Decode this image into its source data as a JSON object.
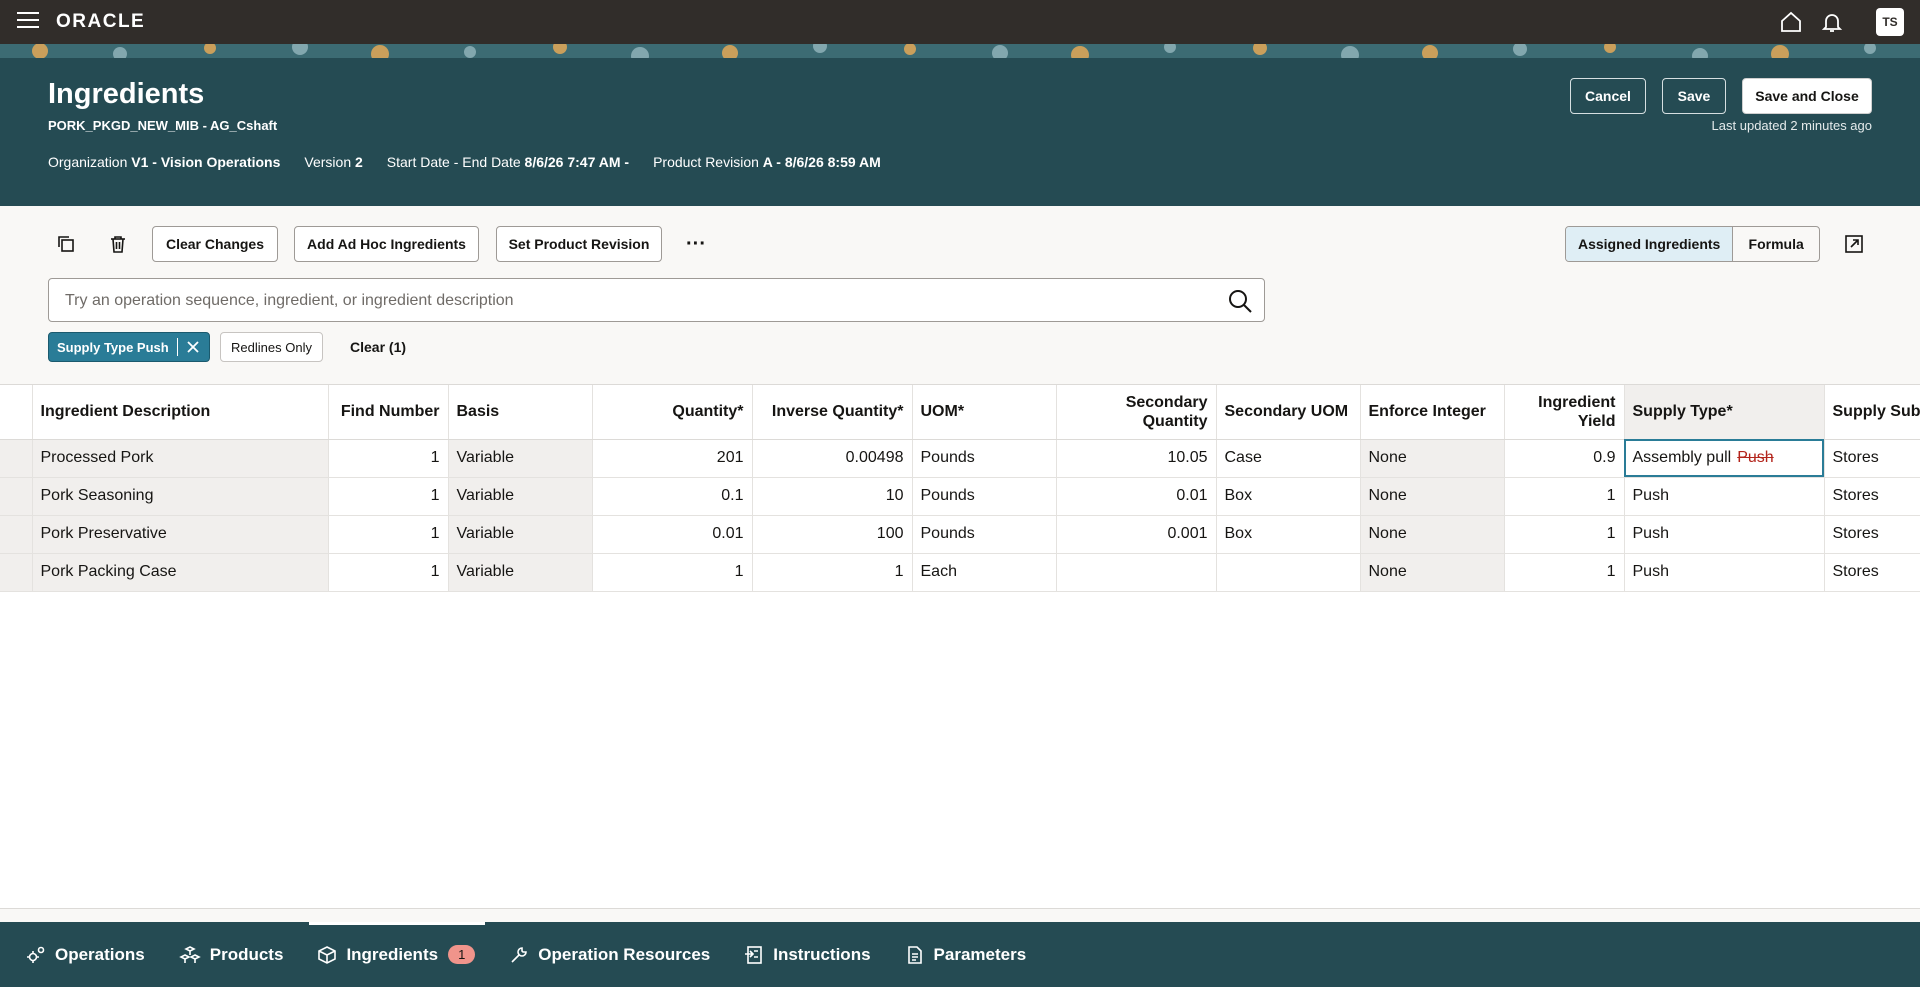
{
  "topbar": {
    "logo": "ORACLE",
    "avatar_initials": "TS",
    "icons": [
      "menu-icon",
      "home-icon",
      "bell-icon"
    ]
  },
  "header": {
    "title": "Ingredients",
    "subtitle": "PORK_PKGD_NEW_MIB - AG_Cshaft",
    "organization_label": "Organization",
    "organization_value": "V1 - Vision Operations",
    "version_label": "Version",
    "version_value": "2",
    "dates_label": "Start Date - End Date",
    "dates_value": "8/6/26 7:47 AM -",
    "revision_label": "Product Revision",
    "revision_value": "A - 8/6/26 8:59 AM",
    "cancel_label": "Cancel",
    "save_label": "Save",
    "save_close_label": "Save and Close",
    "last_updated": "Last updated 2 minutes ago"
  },
  "toolbar": {
    "clear_changes": "Clear Changes",
    "add_adhoc": "Add Ad Hoc Ingredients",
    "set_revision": "Set Product Revision",
    "more": "···",
    "view_assigned": "Assigned Ingredients",
    "view_formula": "Formula",
    "search_placeholder": "Try an operation sequence, ingredient, or ingredient description",
    "search_value": "",
    "chip_supply": "Supply Type Push",
    "chip_redlines": "Redlines Only",
    "clear_filters": "Clear (1)"
  },
  "table": {
    "columns": {
      "desc": "Ingredient Description",
      "find": "Find Number",
      "basis": "Basis",
      "qty": "Quantity*",
      "inv": "Inverse Quantity*",
      "uom": "UOM*",
      "secqty": "Secondary Quantity",
      "secuom": "Secondary UOM",
      "enforce": "Enforce Integer",
      "yield": "Ingredient Yield",
      "supply": "Supply Type*",
      "subinv": "Supply Subi"
    },
    "rows": [
      {
        "desc": "Processed Pork",
        "find": "1",
        "basis": "Variable",
        "qty": "201",
        "inv": "0.00498",
        "uom": "Pounds",
        "secqty": "10.05",
        "secuom": "Case",
        "enforce": "None",
        "yield": "0.9",
        "supply": "Assembly pull",
        "supply_old": "Push",
        "subinv": "Stores"
      },
      {
        "desc": "Pork Seasoning",
        "find": "1",
        "basis": "Variable",
        "qty": "0.1",
        "inv": "10",
        "uom": "Pounds",
        "secqty": "0.01",
        "secuom": "Box",
        "enforce": "None",
        "yield": "1",
        "supply": "Push",
        "supply_old": "",
        "subinv": "Stores"
      },
      {
        "desc": "Pork Preservative",
        "find": "1",
        "basis": "Variable",
        "qty": "0.01",
        "inv": "100",
        "uom": "Pounds",
        "secqty": "0.001",
        "secuom": "Box",
        "enforce": "None",
        "yield": "1",
        "supply": "Push",
        "supply_old": "",
        "subinv": "Stores"
      },
      {
        "desc": "Pork Packing Case",
        "find": "1",
        "basis": "Variable",
        "qty": "1",
        "inv": "1",
        "uom": "Each",
        "secqty": "",
        "secuom": "",
        "enforce": "None",
        "yield": "1",
        "supply": "Push",
        "supply_old": "",
        "subinv": "Stores"
      }
    ]
  },
  "bottom_tabs": [
    {
      "label": "Operations",
      "icon": "gears-icon"
    },
    {
      "label": "Products",
      "icon": "cubes-icon"
    },
    {
      "label": "Ingredients",
      "icon": "box-icon",
      "badge": "1",
      "active": true
    },
    {
      "label": "Operation Resources",
      "icon": "wrench-icon"
    },
    {
      "label": "Instructions",
      "icon": "instructions-icon"
    },
    {
      "label": "Parameters",
      "icon": "parameters-icon"
    }
  ],
  "colors": {
    "header_bg": "#254b53",
    "topbar_bg": "#312d2a",
    "accent": "#2a7c97",
    "badge": "#f0948b",
    "strike": "#b3241b"
  }
}
